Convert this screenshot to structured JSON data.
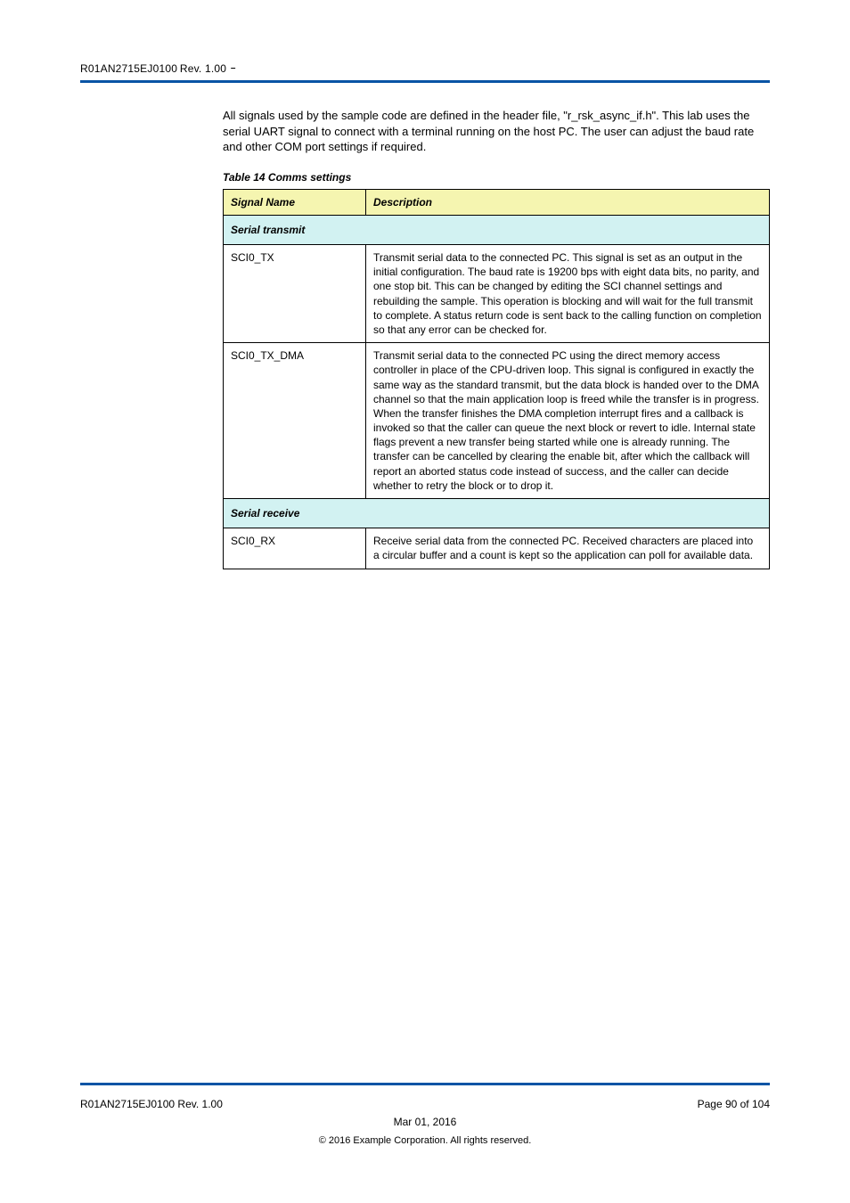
{
  "header": {
    "doc_code": "R01AN2715EJ0100",
    "rev": "Rev. 1.00",
    "mid_mark": "–",
    "page_label": "Page 90 of 104"
  },
  "intro_para": "All signals used by the sample code are defined in the header file, \"r_rsk_async_if.h\". This lab uses the serial UART signal to connect with a terminal running on the host PC. The user can adjust the baud rate and other COM port settings if required.",
  "table_caption": "Table 14 Comms settings",
  "table": {
    "headers": {
      "col1": "Signal Name",
      "col2": "Description"
    },
    "sections": [
      {
        "title": "Serial transmit",
        "rows": [
          {
            "col1": "SCI0_TX",
            "col2": "Transmit serial data to the connected PC. This signal is set as an output in the initial configuration. The baud rate is 19200 bps with eight data bits, no parity, and one stop bit. This can be changed by editing the SCI channel settings and rebuilding the sample. This operation is blocking and will wait for the full transmit to complete. A status return code is sent back to the calling function on completion so that any error can be checked for."
          },
          {
            "col1": "SCI0_TX_DMA",
            "col2": "Transmit serial data to the connected PC using the direct memory access controller in place of the CPU-driven loop. This signal is configured in exactly the same way as the standard transmit, but the data block is handed over to the DMA channel so that the main application loop is freed while the transfer is in progress. When the transfer finishes the DMA completion interrupt fires and a callback is invoked so that the caller can queue the next block or revert to idle. Internal state flags prevent a new transfer being started while one is already running. The transfer can be cancelled by clearing the enable bit, after which the callback will report an aborted status code instead of success, and the caller can decide whether to retry the block or to drop it."
          }
        ]
      },
      {
        "title": "Serial receive",
        "rows": [
          {
            "col1": "SCI0_RX",
            "col2": "Receive serial data from the connected PC. Received characters are placed into a circular buffer and a count is kept so the application can poll for available data."
          }
        ]
      }
    ]
  },
  "footer": {
    "left": "R01AN2715EJ0100 Rev. 1.00",
    "right": "Page 90 of 104",
    "center": "Mar 01, 2016",
    "disclaimer": "© 2016 Example Corporation. All rights reserved."
  }
}
